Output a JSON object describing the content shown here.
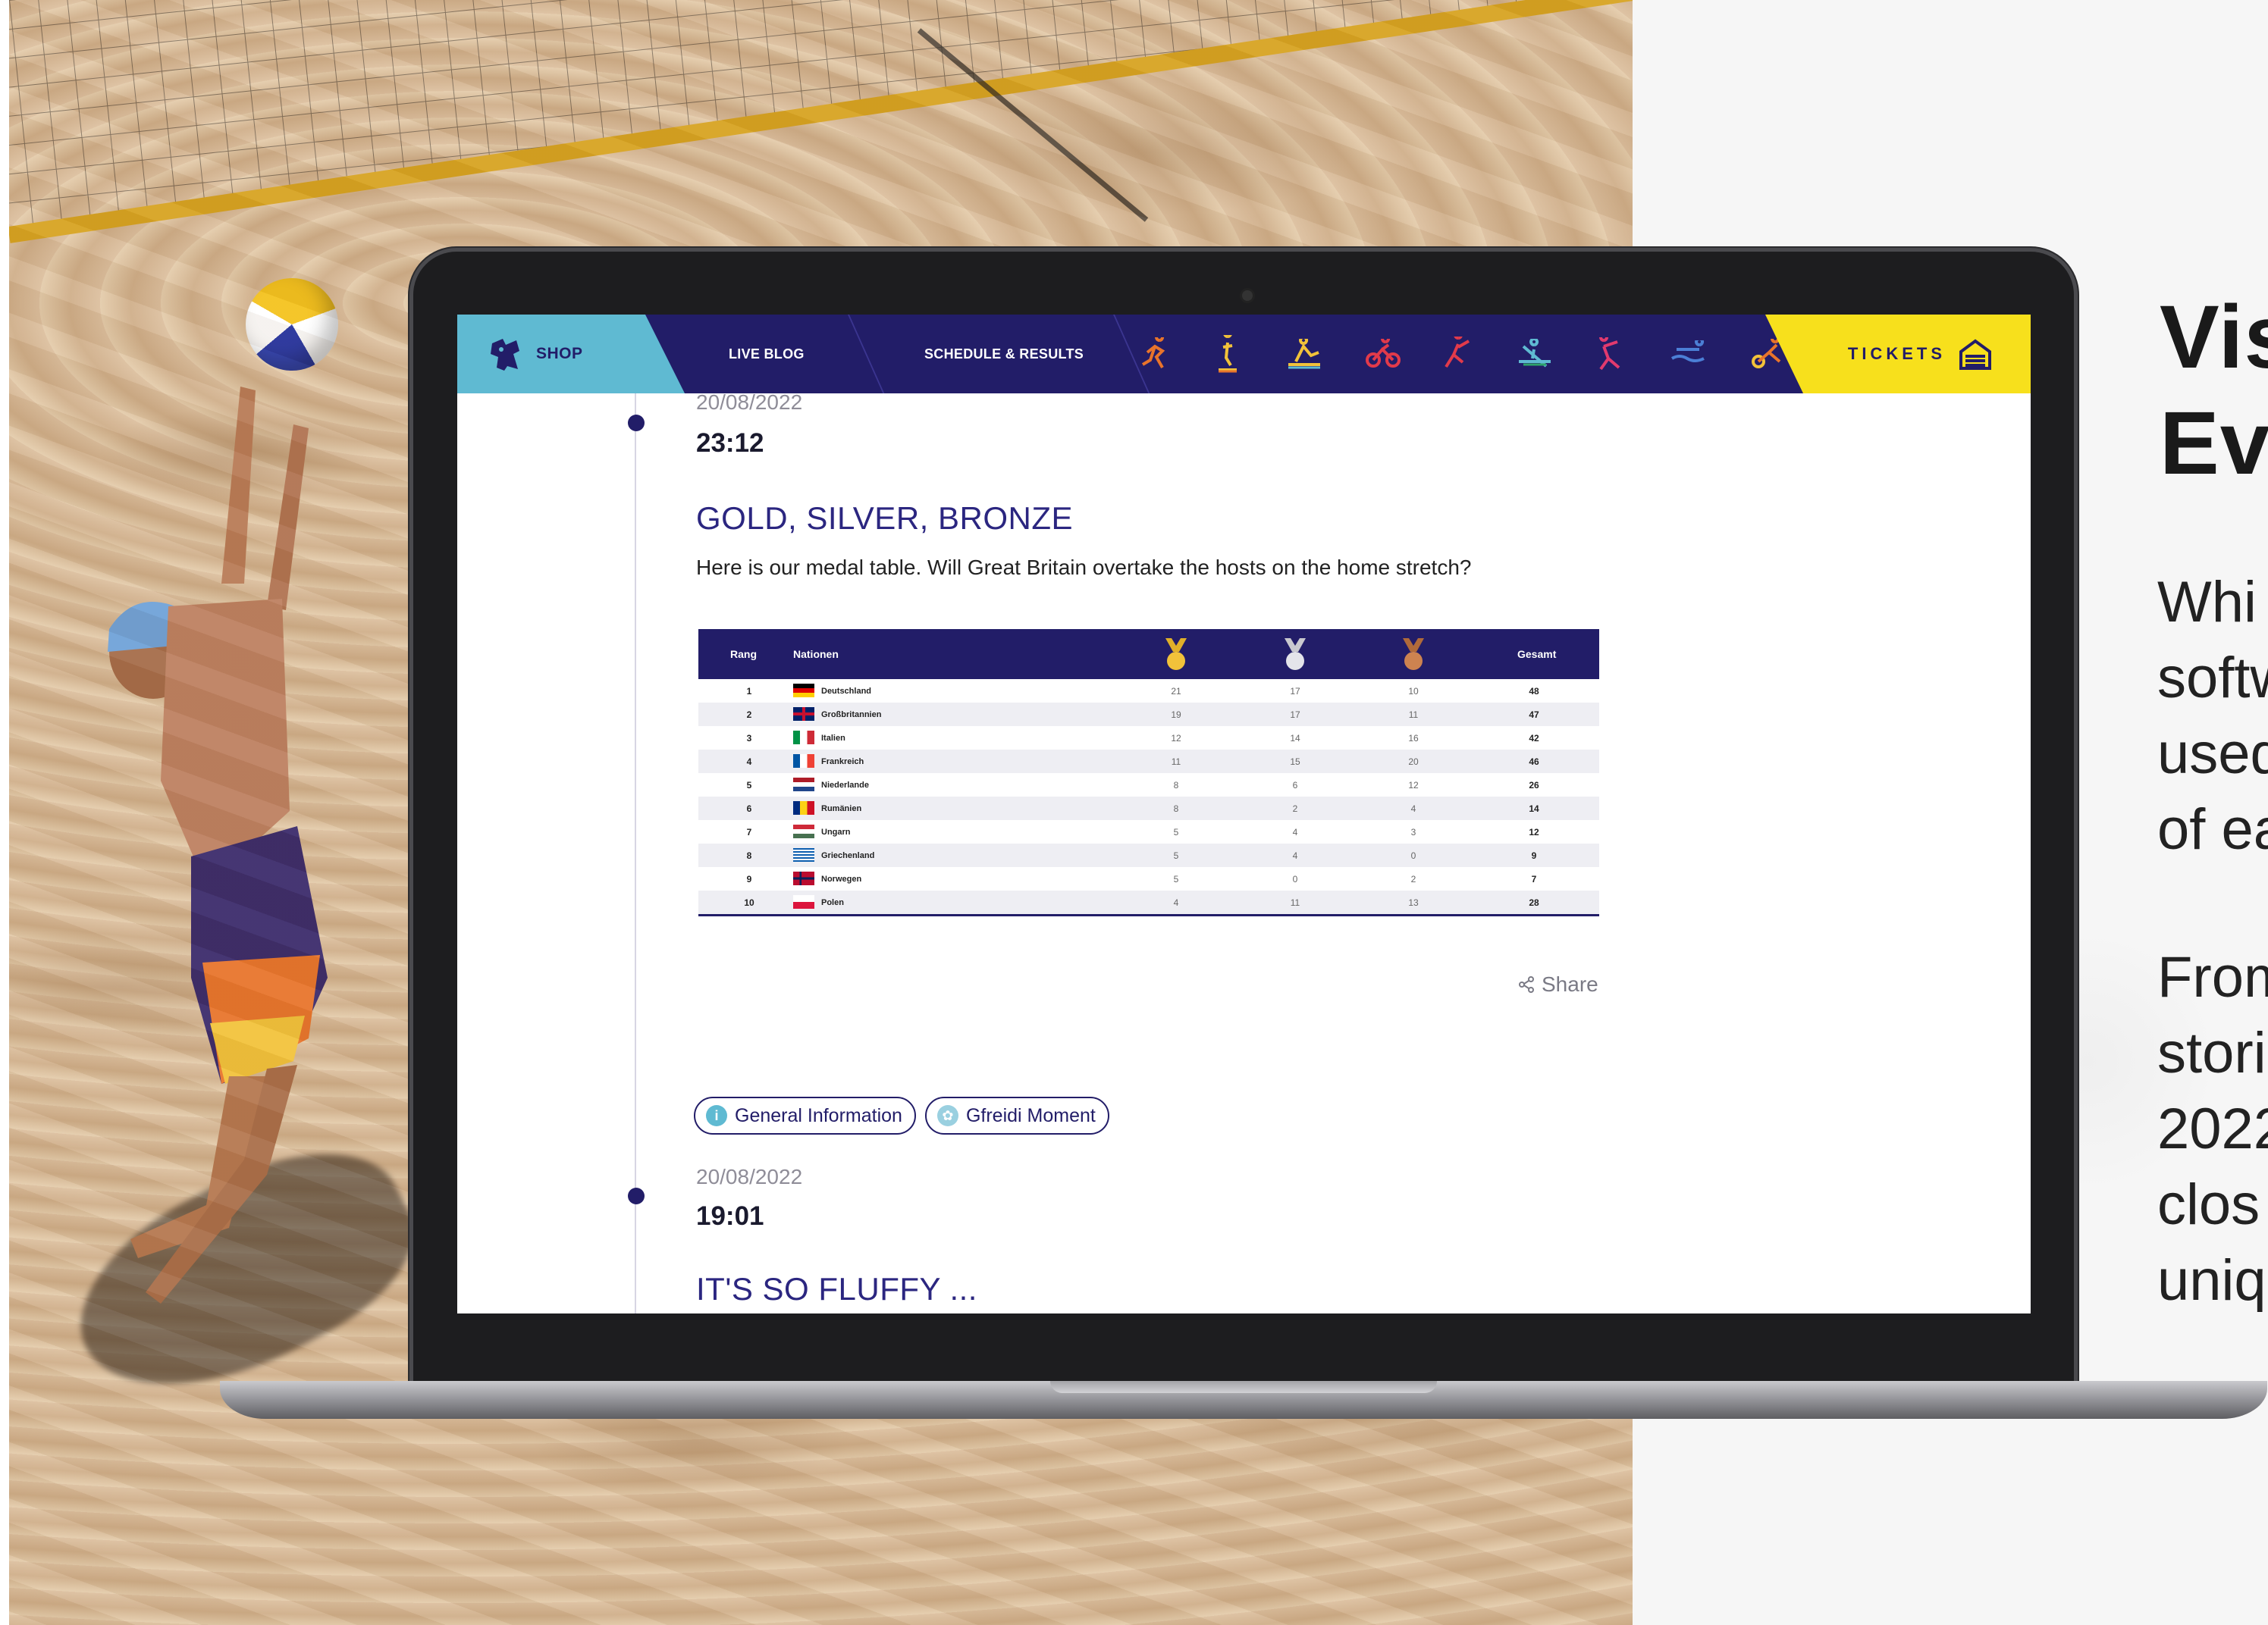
{
  "nav": {
    "shop": "SHOP",
    "live_blog": "LIVE BLOG",
    "schedule": "SCHEDULE & RESULTS",
    "tickets": "TICKETS",
    "sport_icons": [
      "athletics-icon",
      "gymnastics-icon",
      "rowing-icon",
      "cycling-icon",
      "climbing-icon",
      "canoe-icon",
      "beach-volley-icon",
      "swimming-icon",
      "triathlon-icon"
    ],
    "colors": {
      "primary": "#221d68",
      "shop_bg": "#5fbad2",
      "tickets_bg": "#f7e01c"
    }
  },
  "posts": [
    {
      "date": "20/08/2022",
      "time": "23:12",
      "title": "GOLD, SILVER, BRONZE",
      "text": "Here is our medal table. Will Great Britain overtake the hosts on the home stretch?",
      "share": "Share"
    },
    {
      "date": "20/08/2022",
      "time": "19:01",
      "title": "IT'S SO FLUFFY ..."
    }
  ],
  "medal_table": {
    "headers": {
      "rank": "Rang",
      "nations": "Nationen",
      "total": "Gesamt"
    },
    "rows": [
      {
        "rank": "1",
        "nation": "Deutschland",
        "flag": "de",
        "gold": "21",
        "silver": "17",
        "bronze": "10",
        "total": "48"
      },
      {
        "rank": "2",
        "nation": "Großbritannien",
        "flag": "gb",
        "gold": "19",
        "silver": "17",
        "bronze": "11",
        "total": "47"
      },
      {
        "rank": "3",
        "nation": "Italien",
        "flag": "it",
        "gold": "12",
        "silver": "14",
        "bronze": "16",
        "total": "42"
      },
      {
        "rank": "4",
        "nation": "Frankreich",
        "flag": "fr",
        "gold": "11",
        "silver": "15",
        "bronze": "20",
        "total": "46"
      },
      {
        "rank": "5",
        "nation": "Niederlande",
        "flag": "nl",
        "gold": "8",
        "silver": "6",
        "bronze": "12",
        "total": "26"
      },
      {
        "rank": "6",
        "nation": "Rumänien",
        "flag": "ro",
        "gold": "8",
        "silver": "2",
        "bronze": "4",
        "total": "14"
      },
      {
        "rank": "7",
        "nation": "Ungarn",
        "flag": "hu",
        "gold": "5",
        "silver": "4",
        "bronze": "3",
        "total": "12"
      },
      {
        "rank": "8",
        "nation": "Griechenland",
        "flag": "gr",
        "gold": "5",
        "silver": "4",
        "bronze": "0",
        "total": "9"
      },
      {
        "rank": "9",
        "nation": "Norwegen",
        "flag": "no",
        "gold": "5",
        "silver": "0",
        "bronze": "2",
        "total": "7"
      },
      {
        "rank": "10",
        "nation": "Polen",
        "flag": "pl",
        "gold": "4",
        "silver": "11",
        "bronze": "13",
        "total": "28"
      }
    ]
  },
  "tags": [
    "General Information",
    "Gfreidi Moment"
  ],
  "side": {
    "title": "Vis\nEve",
    "p1": "Whi\nsoftw\nused\nof ea",
    "p2": "From\nstori\n2022\nclos\nuniq"
  }
}
